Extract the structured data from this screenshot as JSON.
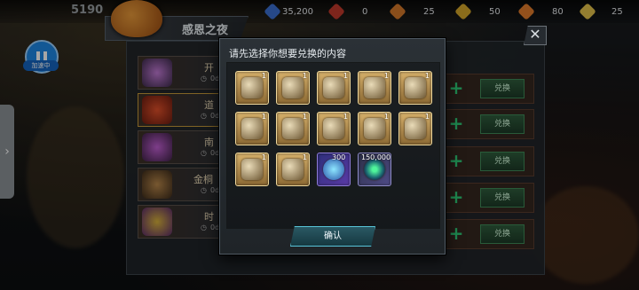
{
  "topbar": {
    "score": "5190",
    "resources": [
      {
        "icon": "chip-icon",
        "value": "35,200",
        "color": "#3b6fd1"
      },
      {
        "icon": "red-gem-icon",
        "value": "0",
        "color": "#c0392b"
      },
      {
        "icon": "fuel-icon",
        "value": "25",
        "color": "#d4782a"
      },
      {
        "icon": "gold-gem-icon",
        "value": "50",
        "color": "#d4a62a"
      },
      {
        "icon": "orange-gem-icon",
        "value": "80",
        "color": "#e07b2b"
      },
      {
        "icon": "yellow-gem-icon",
        "value": "25",
        "color": "#e3c24a"
      }
    ]
  },
  "event": {
    "title": "感恩之夜"
  },
  "pause": {
    "label": "加速中"
  },
  "list": {
    "rows": [
      {
        "name": "开",
        "days": "0d"
      },
      {
        "name": "道",
        "days": "0d"
      },
      {
        "name": "南",
        "days": "0d"
      },
      {
        "name": "金桐",
        "days": "0d"
      },
      {
        "name": "时",
        "days": "0d"
      }
    ],
    "exchange_label": "兑换"
  },
  "dialog": {
    "title": "请先选择你想要兑换的内容",
    "items": [
      {
        "kind": "box",
        "count": "1"
      },
      {
        "kind": "box",
        "count": "1"
      },
      {
        "kind": "box",
        "count": "1"
      },
      {
        "kind": "box",
        "count": "1"
      },
      {
        "kind": "box",
        "count": "1"
      },
      {
        "kind": "box",
        "count": "1"
      },
      {
        "kind": "box",
        "count": "1"
      },
      {
        "kind": "box",
        "count": "1"
      },
      {
        "kind": "box",
        "count": "1"
      },
      {
        "kind": "box",
        "count": "1"
      },
      {
        "kind": "box",
        "count": "1"
      },
      {
        "kind": "box",
        "count": "1"
      },
      {
        "kind": "dna",
        "count": "300"
      },
      {
        "kind": "orb",
        "count": "150,000"
      }
    ],
    "confirm_label": "确认",
    "close_symbol": "✕"
  }
}
